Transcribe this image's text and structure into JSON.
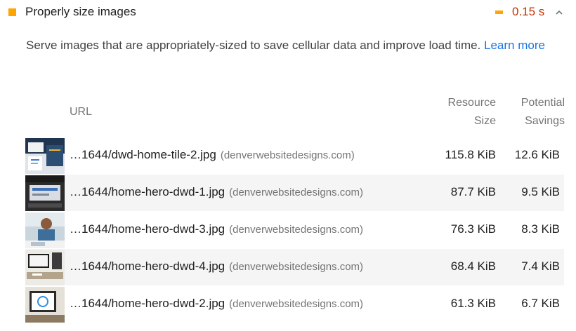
{
  "audit": {
    "title": "Properly size images",
    "savings": "0.15 s",
    "status_color": "#ffa400",
    "savings_color": "#c33300",
    "description": "Serve images that are appropriately-sized to save cellular data and improve load time.",
    "learn_more": "Learn more"
  },
  "table": {
    "headers": {
      "url": "URL",
      "resource_size": [
        "Resource",
        "Size"
      ],
      "potential_savings": [
        "Potential",
        "Savings"
      ]
    },
    "rows": [
      {
        "url": "…1644/dwd-home-tile-2.jpg",
        "domain": "(denverwebsitedesigns.com)",
        "resource_size": "115.8 KiB",
        "potential_savings": "12.6 KiB"
      },
      {
        "url": "…1644/home-hero-dwd-1.jpg",
        "domain": "(denverwebsitedesigns.com)",
        "resource_size": "87.7 KiB",
        "potential_savings": "9.5 KiB"
      },
      {
        "url": "…1644/home-hero-dwd-3.jpg",
        "domain": "(denverwebsitedesigns.com)",
        "resource_size": "76.3 KiB",
        "potential_savings": "8.3 KiB"
      },
      {
        "url": "…1644/home-hero-dwd-4.jpg",
        "domain": "(denverwebsitedesigns.com)",
        "resource_size": "68.4 KiB",
        "potential_savings": "7.4 KiB"
      },
      {
        "url": "…1644/home-hero-dwd-2.jpg",
        "domain": "(denverwebsitedesigns.com)",
        "resource_size": "61.3 KiB",
        "potential_savings": "6.7 KiB"
      }
    ]
  }
}
